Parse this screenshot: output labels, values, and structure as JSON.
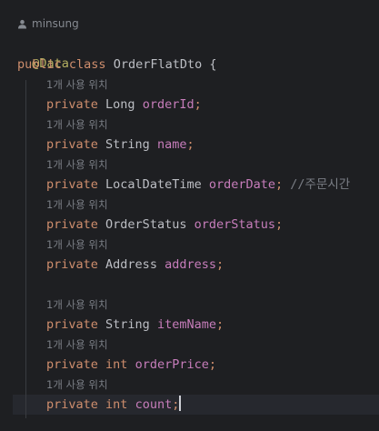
{
  "author": {
    "name": "minsung",
    "icon": "user-icon"
  },
  "annotation": "@Data",
  "class_decl": {
    "mod": "public",
    "kw": "class",
    "name": "OrderFlatDto",
    "brace": " {"
  },
  "usage_hint": "1개 사용 위치",
  "fields": [
    {
      "mod": "private",
      "type": "Long",
      "type_is_kw": false,
      "name": "orderId",
      "comment": ""
    },
    {
      "mod": "private",
      "type": "String",
      "type_is_kw": false,
      "name": "name",
      "comment": ""
    },
    {
      "mod": "private",
      "type": "LocalDateTime",
      "type_is_kw": false,
      "name": "orderDate",
      "comment": "//주문시간"
    },
    {
      "mod": "private",
      "type": "OrderStatus",
      "type_is_kw": false,
      "name": "orderStatus",
      "comment": ""
    },
    {
      "mod": "private",
      "type": "Address",
      "type_is_kw": false,
      "name": "address",
      "comment": ""
    },
    {
      "mod": "private",
      "type": "String",
      "type_is_kw": false,
      "name": "itemName",
      "comment": ""
    },
    {
      "mod": "private",
      "type": "int",
      "type_is_kw": true,
      "name": "orderPrice",
      "comment": ""
    },
    {
      "mod": "private",
      "type": "int",
      "type_is_kw": true,
      "name": "count",
      "comment": ""
    }
  ]
}
